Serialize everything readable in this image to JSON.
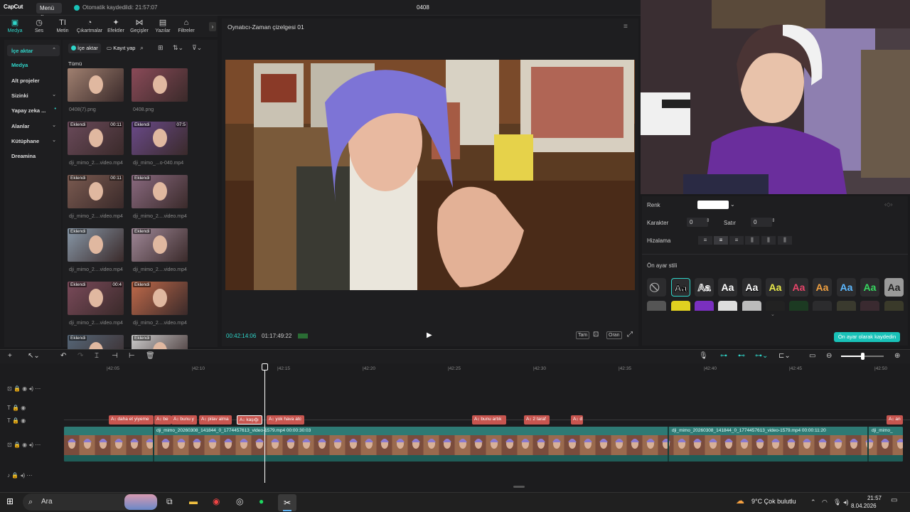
{
  "app": {
    "logo": "CapCut",
    "menu_label": "Menü",
    "autosave": "Otomatik kaydedildi: 21:57:07",
    "project_name": "0408"
  },
  "tabs": [
    {
      "label": "Medya",
      "icon": "media-icon"
    },
    {
      "label": "Ses",
      "icon": "audio-icon"
    },
    {
      "label": "Metin",
      "icon": "text-icon"
    },
    {
      "label": "Çıkartmalar",
      "icon": "sticker-icon"
    },
    {
      "label": "Efektler",
      "icon": "effects-icon"
    },
    {
      "label": "Geçişler",
      "icon": "transitions-icon"
    },
    {
      "label": "Yazılar",
      "icon": "captions-icon"
    },
    {
      "label": "Filtreler",
      "icon": "filters-icon"
    }
  ],
  "sidenav": [
    {
      "label": "İçe aktar"
    },
    {
      "label": "Medya"
    },
    {
      "label": "Alt projeler"
    },
    {
      "label": "Sizinki"
    },
    {
      "label": "Yapay zeka ..."
    },
    {
      "label": "Alanlar"
    },
    {
      "label": "Kütüphane"
    },
    {
      "label": "Dreamina"
    }
  ],
  "media": {
    "import_label": "İçe aktar",
    "record_label": "Kayıt yap",
    "all_label": "Tümü",
    "items": [
      {
        "name": "0408(7).png",
        "badge": "",
        "duration": ""
      },
      {
        "name": "0408.png",
        "badge": "",
        "duration": ""
      },
      {
        "name": "dji_mimo_2....video.mp4",
        "badge": "Eklendi",
        "duration": "00:11"
      },
      {
        "name": "dji_mimo_...o-040.mp4",
        "badge": "Eklendi",
        "duration": "07:5"
      },
      {
        "name": "dji_mimo_2....video.mp4",
        "badge": "Eklendi",
        "duration": "00:11"
      },
      {
        "name": "dji_mimo_2....video.mp4",
        "badge": "Eklendi",
        "duration": ""
      },
      {
        "name": "dji_mimo_2....video.mp4",
        "badge": "Eklendi",
        "duration": ""
      },
      {
        "name": "dji_mimo_2....video.mp4",
        "badge": "Eklendi",
        "duration": ""
      },
      {
        "name": "dji_mimo_2....video.mp4",
        "badge": "Eklendi",
        "duration": "00:4"
      },
      {
        "name": "dji_mimo_2....video.mp4",
        "badge": "Eklendi",
        "duration": ""
      },
      {
        "name": "",
        "badge": "Eklendi",
        "duration": ""
      },
      {
        "name": "",
        "badge": "Eklendi",
        "duration": ""
      }
    ]
  },
  "player": {
    "title": "Oynatıcı-Zaman çizelgesi 01",
    "current_time": "00:42:14:06",
    "total_time": "01:17:49:22",
    "btn_full": "Tam",
    "btn_ratio": "Oran"
  },
  "props": {
    "color_label": "Renk",
    "char_label": "Karakter",
    "char_value": "0",
    "line_label": "Satır",
    "line_value": "0",
    "align_label": "Hizalama",
    "preset_label": "Ön ayar stili",
    "preset_text": "Aa",
    "save_preset": "Ön ayar olarak kaydedin"
  },
  "timeline": {
    "ticks": [
      "|42:05",
      "|42:10",
      "|42:15",
      "|42:20",
      "|42:25",
      "|42:30",
      "|42:35",
      "|42:40",
      "|42:45",
      "|42:50"
    ],
    "text_clips": [
      "daha et yiyeme",
      "be",
      "bunu y",
      "pilav alma",
      "kaşığı",
      "yok hava atc",
      "bunu artık",
      "2 taraf",
      "d",
      "an"
    ],
    "video_labels": [
      "dji_mimo_20260308_141844_0_1774457613_video-1579.mp4    00:00:30:03",
      "dji_mimo_20260308_141844_0_1774457613_video-1579.mp4    00:00:11:20",
      "dji_mimo_"
    ]
  },
  "taskbar": {
    "search_placeholder": "Ara",
    "weather": "9°C  Çok bulutlu",
    "time": "21:57",
    "date": "8.04.2026"
  },
  "colors": {
    "accent": "#2fd5c9",
    "text_clip": "#c7554f",
    "video_track": "#2e7a74"
  }
}
